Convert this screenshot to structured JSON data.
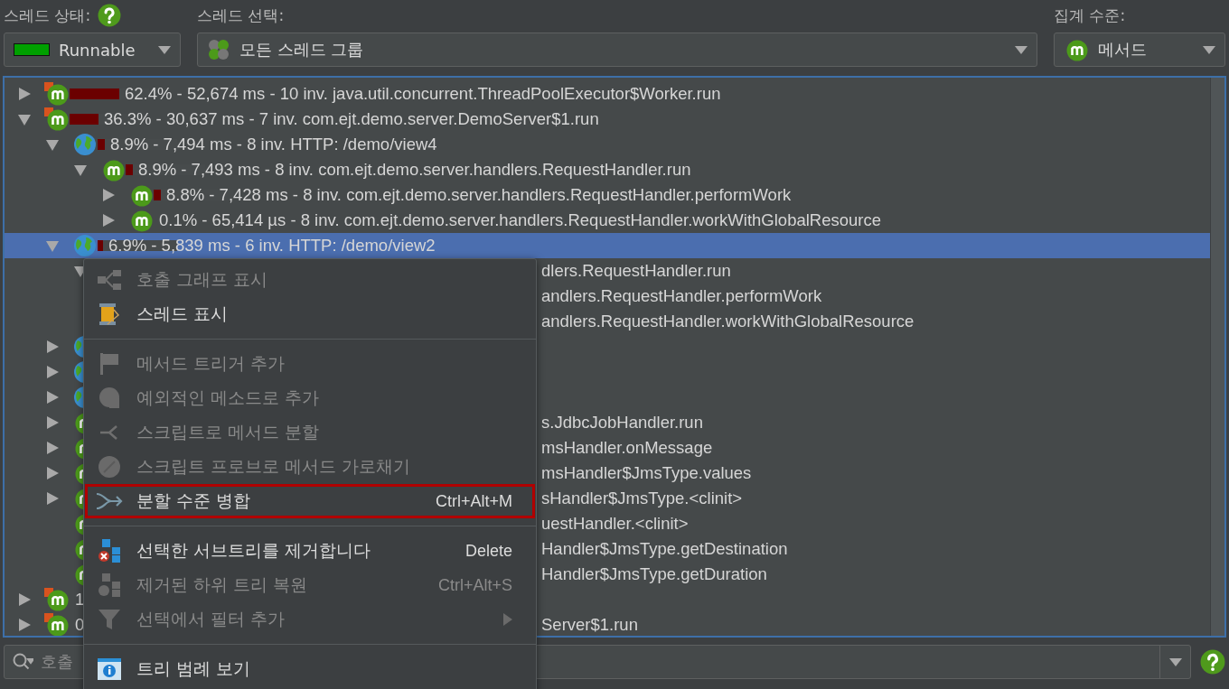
{
  "toolbar": {
    "thread_status": {
      "label": "스레드 상태:",
      "value": "Runnable",
      "color": "#00a000"
    },
    "thread_selection": {
      "label": "스레드 선택:",
      "value": "모든 스레드 그룹"
    },
    "aggregation": {
      "label": "집계 수준:",
      "value": "메서드"
    }
  },
  "tree": [
    {
      "kind": "method",
      "hot": true,
      "expanded": false,
      "selected": false,
      "level": 0.624,
      "text": "62.4% - 52,674 ms - 10 inv. java.util.concurrent.ThreadPoolExecutor$Worker.run"
    },
    {
      "kind": "method",
      "hot": true,
      "expanded": true,
      "selected": false,
      "level": 0.363,
      "text": "36.3% - 30,637 ms - 7 inv. com.ejt.demo.server.DemoServer$1.run",
      "children": [
        {
          "kind": "url",
          "expanded": true,
          "selected": false,
          "level": 0.089,
          "text": "8.9% - 7,494 ms - 8 inv. HTTP: /demo/view4",
          "children": [
            {
              "kind": "method",
              "hot": false,
              "expanded": true,
              "selected": false,
              "level": 0.089,
              "text": "8.9% - 7,493 ms - 8 inv. com.ejt.demo.server.handlers.RequestHandler.run",
              "children": [
                {
                  "kind": "method",
                  "hot": false,
                  "expanded": false,
                  "selected": false,
                  "level": 0.088,
                  "text": "8.8% - 7,428 ms - 8 inv. com.ejt.demo.server.handlers.RequestHandler.performWork"
                },
                {
                  "kind": "method",
                  "hot": false,
                  "expanded": false,
                  "selected": false,
                  "text": "0.1% - 65,414 µs - 8 inv. com.ejt.demo.server.handlers.RequestHandler.workWithGlobalResource"
                }
              ]
            }
          ]
        },
        {
          "kind": "url",
          "expanded": true,
          "selected": true,
          "level": 0.069,
          "text": "6.9% - 5,839 ms - 6 inv. HTTP: /demo/view2",
          "children": [
            {
              "expanded": true,
              "selected": false,
              "text_tail": "dlers.RequestHandler.run",
              "children": [
                {
                  "selected": false,
                  "text_tail": "andlers.RequestHandler.performWork"
                },
                {
                  "selected": false,
                  "text_tail": "andlers.RequestHandler.workWithGlobalResource"
                }
              ]
            }
          ]
        },
        {
          "kind": "url",
          "expanded": false,
          "selected": false
        },
        {
          "kind": "url",
          "expanded": false,
          "selected": false
        },
        {
          "kind": "url",
          "expanded": false,
          "selected": false
        },
        {
          "kind": "method",
          "hot": false,
          "expanded": false,
          "selected": false,
          "text_tail": "s.JdbcJobHandler.run"
        },
        {
          "kind": "method",
          "hot": false,
          "expanded": false,
          "selected": false,
          "text_tail": "msHandler.onMessage"
        },
        {
          "kind": "method",
          "hot": false,
          "expanded": false,
          "selected": false,
          "text_tail": "msHandler$JmsType.values"
        },
        {
          "kind": "method",
          "hot": false,
          "expanded": false,
          "selected": false,
          "text_tail": "sHandler$JmsType.<clinit>"
        },
        {
          "kind": "method",
          "hot": false,
          "selected": false,
          "text_tail": "uestHandler.<clinit>"
        },
        {
          "kind": "method",
          "hot": false,
          "selected": false,
          "text_tail": "Handler$JmsType.getDestination"
        },
        {
          "kind": "method",
          "hot": false,
          "selected": false,
          "text_tail": "Handler$JmsType.getDuration"
        }
      ]
    },
    {
      "kind": "method",
      "hot": true,
      "expanded": false,
      "selected": false,
      "text_head": "1"
    },
    {
      "kind": "method",
      "hot": true,
      "expanded": false,
      "selected": false,
      "text_head": "0",
      "text_tail": "Server$1.run"
    }
  ],
  "context_menu": [
    {
      "kind": "item",
      "label": "호출 그래프 표시",
      "disabled": true,
      "highlighted": false
    },
    {
      "kind": "item",
      "label": "스레드 표시",
      "disabled": false,
      "highlighted": false
    },
    {
      "kind": "separator"
    },
    {
      "kind": "item",
      "label": "메서드 트리거 추가",
      "disabled": true,
      "highlighted": false
    },
    {
      "kind": "item",
      "label": "예외적인 메소드로 추가",
      "disabled": true,
      "highlighted": false
    },
    {
      "kind": "item",
      "label": "스크립트로 메서드 분할",
      "disabled": true,
      "highlighted": false
    },
    {
      "kind": "item",
      "label": "스크립트 프로브로 메서드 가로채기",
      "disabled": true,
      "highlighted": false
    },
    {
      "kind": "item",
      "label": "분할 수준 병합",
      "shortcut": "Ctrl+Alt+M",
      "disabled": false,
      "highlighted": true
    },
    {
      "kind": "separator"
    },
    {
      "kind": "item",
      "label": "선택한 서브트리를 제거합니다",
      "shortcut": "Delete",
      "disabled": false,
      "highlighted": false
    },
    {
      "kind": "item",
      "label": "제거된 하위 트리 복원",
      "shortcut": "Ctrl+Alt+S",
      "disabled": true,
      "highlighted": false
    },
    {
      "kind": "item",
      "label": "선택에서 필터 추가",
      "disabled": true,
      "highlighted": false,
      "submenu": true
    },
    {
      "kind": "separator"
    },
    {
      "kind": "item",
      "label": "트리 범례 보기",
      "disabled": false,
      "highlighted": false
    }
  ],
  "search": {
    "placeholder": "호출"
  }
}
